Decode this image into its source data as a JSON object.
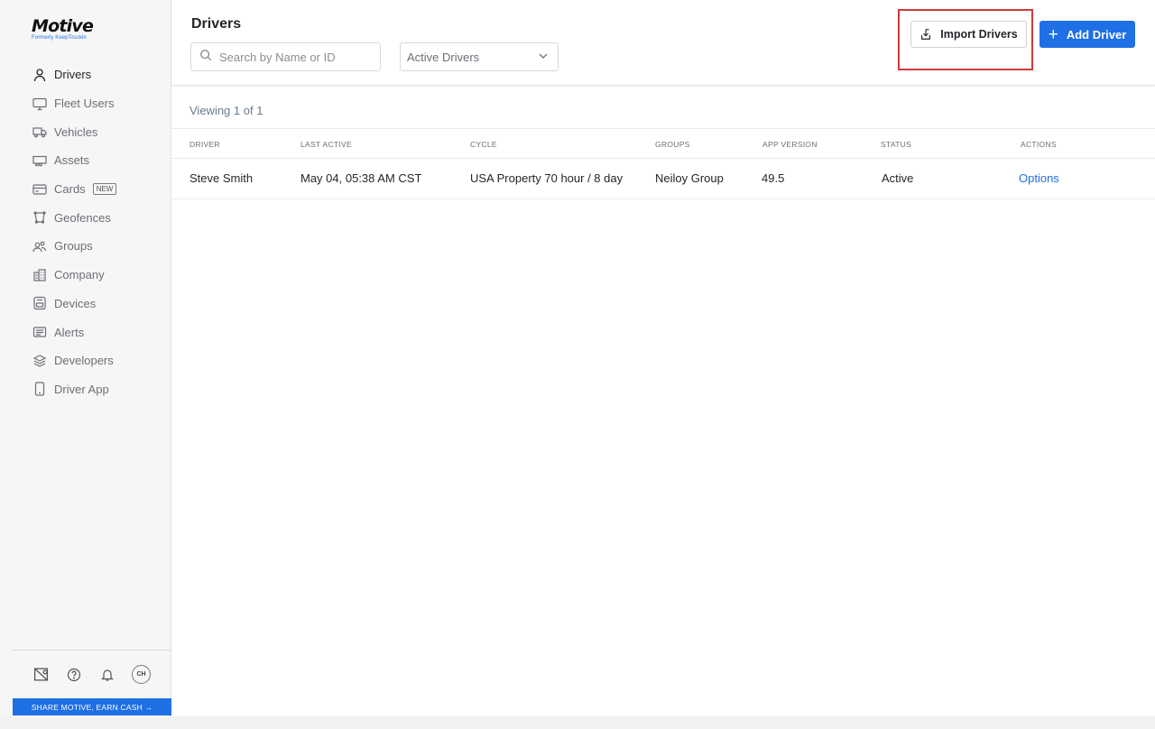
{
  "brand": {
    "name": "Motive",
    "tagline": "Formerly KeepTruckin"
  },
  "sidebar": {
    "items": [
      {
        "label": "Drivers",
        "icon": "user-icon",
        "active": true
      },
      {
        "label": "Fleet Users",
        "icon": "monitor-icon"
      },
      {
        "label": "Vehicles",
        "icon": "truck-icon"
      },
      {
        "label": "Assets",
        "icon": "trailer-icon"
      },
      {
        "label": "Cards",
        "icon": "card-icon",
        "badge": "NEW"
      },
      {
        "label": "Geofences",
        "icon": "geofence-icon"
      },
      {
        "label": "Groups",
        "icon": "groups-icon"
      },
      {
        "label": "Company",
        "icon": "building-icon"
      },
      {
        "label": "Devices",
        "icon": "device-icon"
      },
      {
        "label": "Alerts",
        "icon": "alert-icon"
      },
      {
        "label": "Developers",
        "icon": "layers-icon"
      },
      {
        "label": "Driver App",
        "icon": "phone-icon"
      }
    ],
    "avatar_initials": "CH",
    "share_banner": "SHARE MOTIVE, EARN CASH →"
  },
  "header": {
    "title": "Drivers",
    "search_placeholder": "Search by Name or ID",
    "filter_selected": "Active Drivers",
    "import_label": "Import Drivers",
    "add_label": "Add Driver"
  },
  "main": {
    "viewing": "Viewing 1 of 1",
    "columns": [
      "DRIVER",
      "LAST ACTIVE",
      "CYCLE",
      "GROUPS",
      "APP VERSION",
      "STATUS",
      "ACTIONS"
    ],
    "rows": [
      {
        "driver": "Steve Smith",
        "last_active": "May 04, 05:38 AM CST",
        "cycle": "USA Property 70 hour / 8 day",
        "groups": "Neiloy Group",
        "app_version": "49.5",
        "status": "Active",
        "actions": "Options"
      }
    ]
  },
  "colors": {
    "accent": "#1f6fe5",
    "highlight": "#cf3a3a"
  }
}
